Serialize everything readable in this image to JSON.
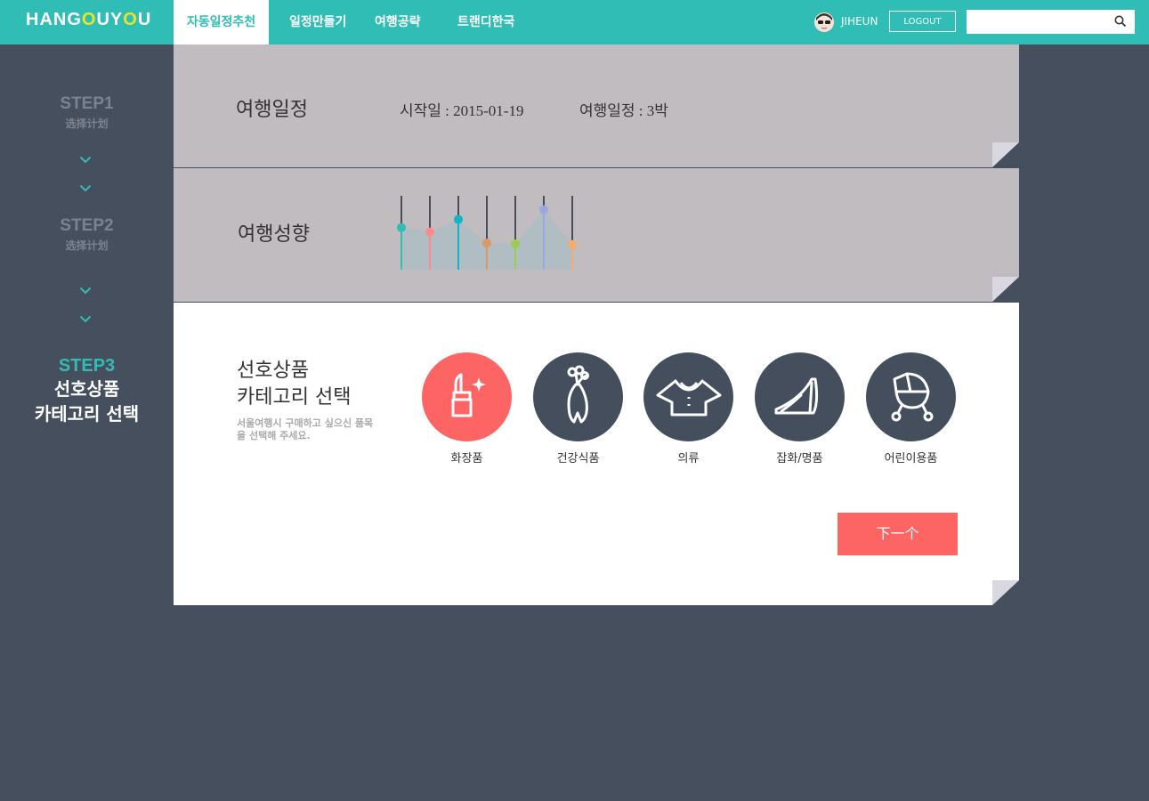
{
  "header": {
    "logo": {
      "part1": "HANG",
      "o1": "O",
      "part2": "UY",
      "o2": "O",
      "part3": "U"
    },
    "nav": [
      {
        "label": "자동일정추천",
        "active": true
      },
      {
        "label": "일정만들기",
        "active": false
      },
      {
        "label": "여행공략",
        "active": false
      },
      {
        "label": "트랜디한국",
        "active": false
      }
    ],
    "user": {
      "name": "JIHEUN",
      "avatar_icon": "user-avatar"
    },
    "logout_label": "LOGOUT",
    "search": {
      "value": "",
      "placeholder": "",
      "icon": "search-icon"
    }
  },
  "sidebar": {
    "steps": [
      {
        "title": "STEP1",
        "subtitle": "选择计划",
        "active": false
      },
      {
        "title": "STEP2",
        "subtitle": "选择计划",
        "active": false
      },
      {
        "title": "STEP3",
        "subtitle": "선호상품\n카테고리 선택",
        "active": true
      }
    ],
    "chevron_icon": "chevron-down-icon"
  },
  "schedule": {
    "title": "여행일정",
    "start": "시작일 : 2015-01-19",
    "duration": "여행일정 : 3박"
  },
  "tendency": {
    "title": "여행성향",
    "bars": [
      {
        "level": 0.57,
        "color": "#2fbdb5"
      },
      {
        "level": 0.51,
        "color": "#f88c8c"
      },
      {
        "level": 0.68,
        "color": "#12b3c7"
      },
      {
        "level": 0.36,
        "color": "#d99a66"
      },
      {
        "level": 0.35,
        "color": "#9ccd52"
      },
      {
        "level": 0.81,
        "color": "#98a8e2"
      },
      {
        "level": 0.34,
        "color": "#f3ad72"
      }
    ]
  },
  "preference": {
    "title_line1": "선호상품",
    "title_line2": "카테고리 선택",
    "description": "서울여행시 구매하고 싶으신 품목을 선택해 주세요.",
    "categories": [
      {
        "label": "화장품",
        "icon": "lipstick-icon",
        "selected": true
      },
      {
        "label": "건강식품",
        "icon": "ginseng-icon",
        "selected": false
      },
      {
        "label": "의류",
        "icon": "shirt-icon",
        "selected": false
      },
      {
        "label": "잡화/명품",
        "icon": "high-heel-icon",
        "selected": false
      },
      {
        "label": "어린이용품",
        "icon": "stroller-icon",
        "selected": false
      }
    ],
    "next_label": "下一个"
  },
  "colors": {
    "accent": "#2fbdb5",
    "background": "#464f5e",
    "panel_gray": "#c1bcbf",
    "highlight": "#fd6565",
    "dark_circle": "#454e5d"
  }
}
